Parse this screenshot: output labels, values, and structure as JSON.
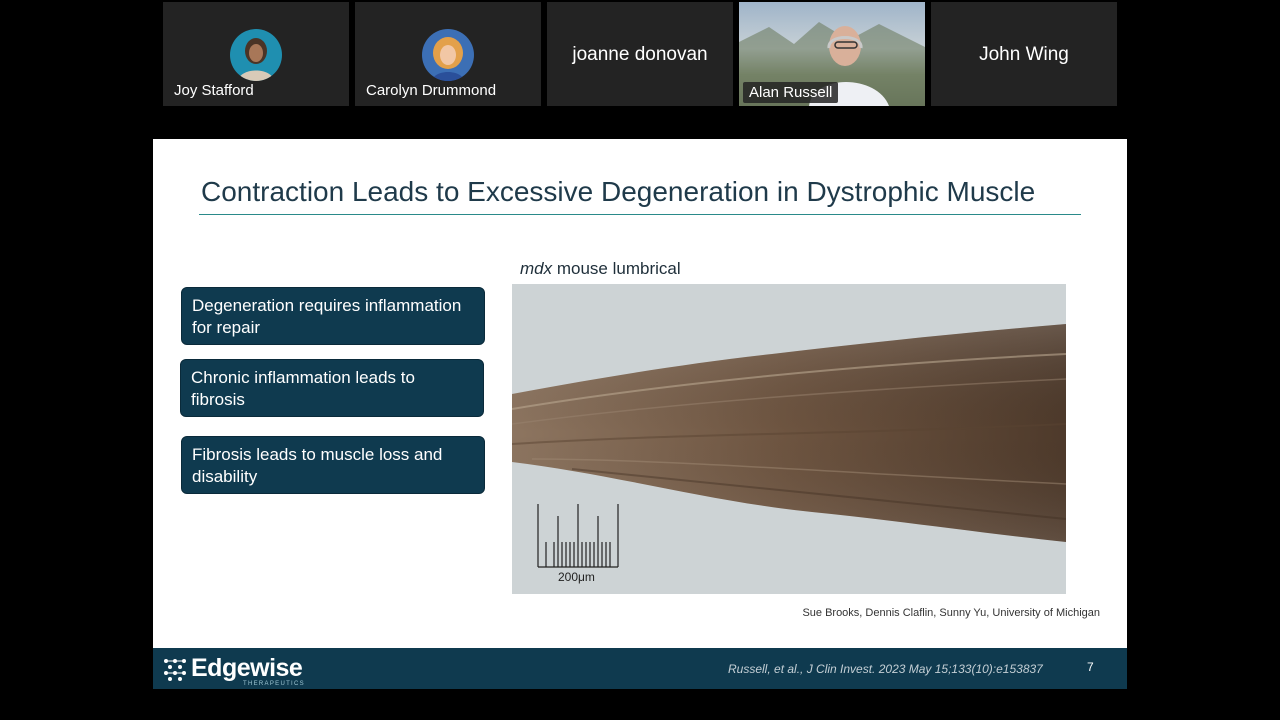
{
  "participants": [
    {
      "name": "Joy Stafford",
      "type": "avatar"
    },
    {
      "name": "Carolyn Drummond",
      "type": "avatar"
    },
    {
      "name": "joanne donovan",
      "type": "name-only"
    },
    {
      "name": "Alan Russell",
      "type": "video"
    },
    {
      "name": "John Wing",
      "type": "name-only"
    }
  ],
  "slide": {
    "title": "Contraction Leads to Excessive Degeneration in Dystrophic Muscle",
    "callouts": [
      "Degeneration requires inflammation for repair",
      "Chronic inflammation leads to fibrosis",
      "Fibrosis leads to muscle loss and disability"
    ],
    "image_caption_italic": "mdx",
    "image_caption_rest": " mouse lumbrical",
    "scale_bar_label": "200μm",
    "credit": "Sue Brooks, Dennis Claflin, Sunny Yu, University of Michigan",
    "footer": {
      "logo_text": "Edgewise",
      "logo_subtext": "THERAPEUTICS",
      "reference": "Russell, et al., J Clin Invest. 2023 May 15;133(10):e153837",
      "page_number": "7"
    }
  },
  "colors": {
    "slide_accent": "#0f3a4f",
    "title_text": "#1f3a4a",
    "title_rule": "#2a8a8a"
  }
}
